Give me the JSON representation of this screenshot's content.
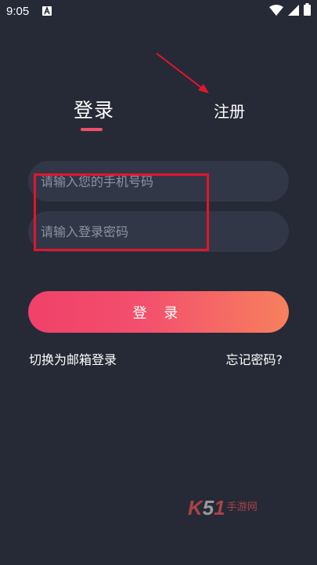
{
  "status_bar": {
    "time": "9:05"
  },
  "tabs": {
    "login": "登录",
    "register": "注册"
  },
  "form": {
    "phone_placeholder": "请输入您的手机号码",
    "password_placeholder": "请输入登录密码",
    "login_button": "登 录"
  },
  "links": {
    "switch_email": "切换为邮箱登录",
    "forgot_password": "忘记密码?"
  },
  "watermark": {
    "k": "K",
    "five": "5",
    "one": "1",
    "text": "手游网"
  },
  "colors": {
    "background": "#262a36",
    "input_background": "#323748",
    "accent": "#ee4f6a",
    "annotation": "#e0162c"
  }
}
